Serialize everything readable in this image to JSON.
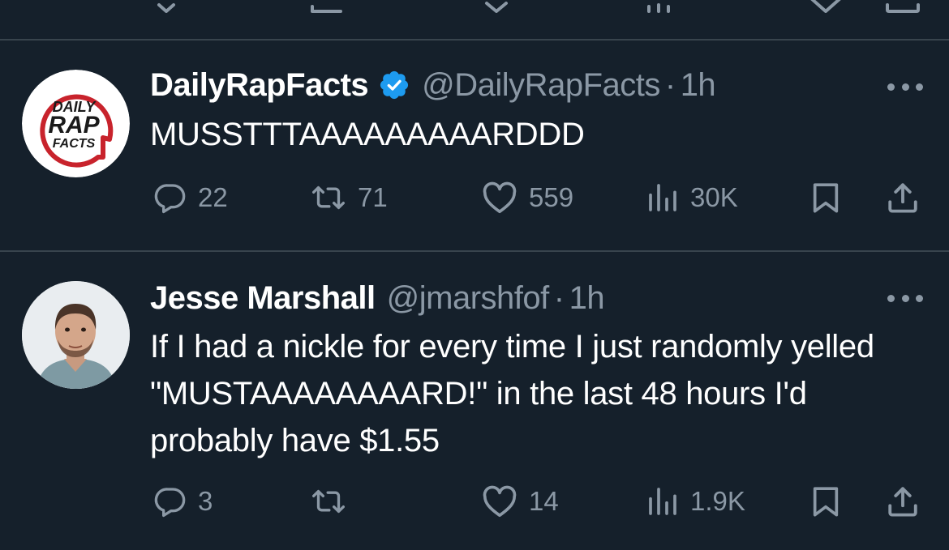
{
  "tweets": [
    {
      "name": "DailyRapFacts",
      "verified": true,
      "handle": "@DailyRapFacts",
      "separator": "·",
      "time": "1h",
      "text": "MUSSTTTAAAAAAAAARDDD",
      "avatar": {
        "logo_lines": [
          "DAILY",
          "RAP",
          "FACTS"
        ],
        "colors": {
          "ring": "#c8232c",
          "text": "#1a1a1a",
          "bg": "#ffffff"
        }
      },
      "stats": {
        "replies": "22",
        "reposts": "71",
        "likes": "559",
        "views": "30K"
      }
    },
    {
      "name": "Jesse Marshall",
      "verified": false,
      "handle": "@jmarshfof",
      "separator": "·",
      "time": "1h",
      "text": "If I had a nickle for every time I just randomly yelled \"MUSTAAAAAAAARD!\" in the last 48 hours I'd probably have $1.55",
      "avatar": {
        "kind": "photo-of-man"
      },
      "stats": {
        "replies": "3",
        "reposts": "",
        "likes": "14",
        "views": "1.9K"
      }
    }
  ],
  "icons": {
    "reply": "reply-icon",
    "repost": "repost-icon",
    "like": "like-icon",
    "views": "views-icon",
    "bookmark": "bookmark-icon",
    "share": "share-icon",
    "more": "more-icon",
    "verified": "verified-badge-icon"
  },
  "colors": {
    "background": "#15202b",
    "divider": "#38444d",
    "secondary_text": "#8b98a5",
    "verified_blue": "#1d9bf0",
    "primary_text": "#ffffff"
  }
}
